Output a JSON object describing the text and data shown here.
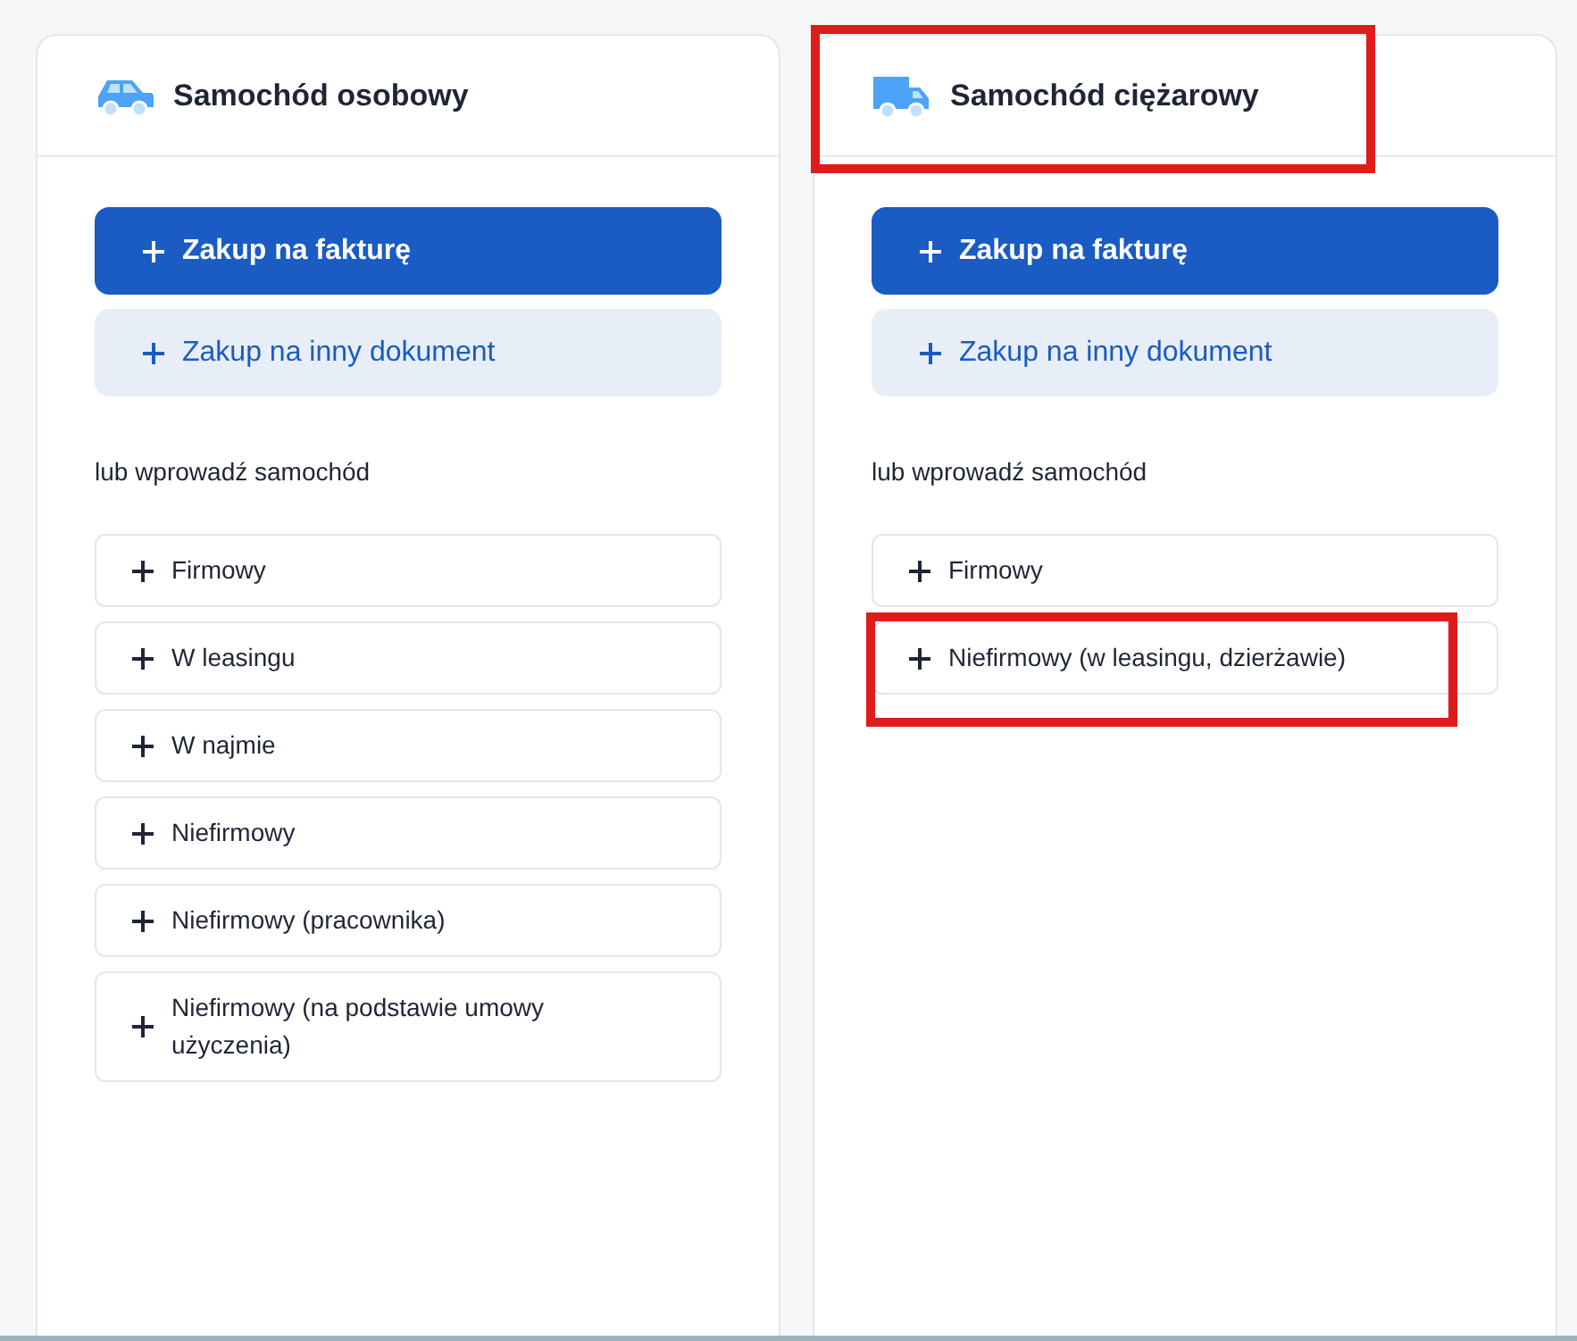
{
  "cards": [
    {
      "kind": "car",
      "title": "Samochód osobowy",
      "highlighted": false,
      "primary_button": "Zakup na fakturę",
      "secondary_button": "Zakup na inny dokument",
      "prompt": "lub wprowadź samochód",
      "items": [
        {
          "label": "Firmowy",
          "highlighted": false
        },
        {
          "label": "W leasingu",
          "highlighted": false
        },
        {
          "label": "W najmie",
          "highlighted": false
        },
        {
          "label": "Niefirmowy",
          "highlighted": false
        },
        {
          "label": "Niefirmowy (pracownika)",
          "highlighted": false
        },
        {
          "label": "Niefirmowy (na podstawie umowy użyczenia)",
          "highlighted": false
        }
      ]
    },
    {
      "kind": "truck",
      "title": "Samochód ciężarowy",
      "highlighted": true,
      "primary_button": "Zakup na fakturę",
      "secondary_button": "Zakup na inny dokument",
      "prompt": "lub wprowadź samochód",
      "items": [
        {
          "label": "Firmowy",
          "highlighted": false
        },
        {
          "label": "Niefirmowy (w leasingu, dzierżawie)",
          "highlighted": true
        }
      ]
    }
  ]
}
